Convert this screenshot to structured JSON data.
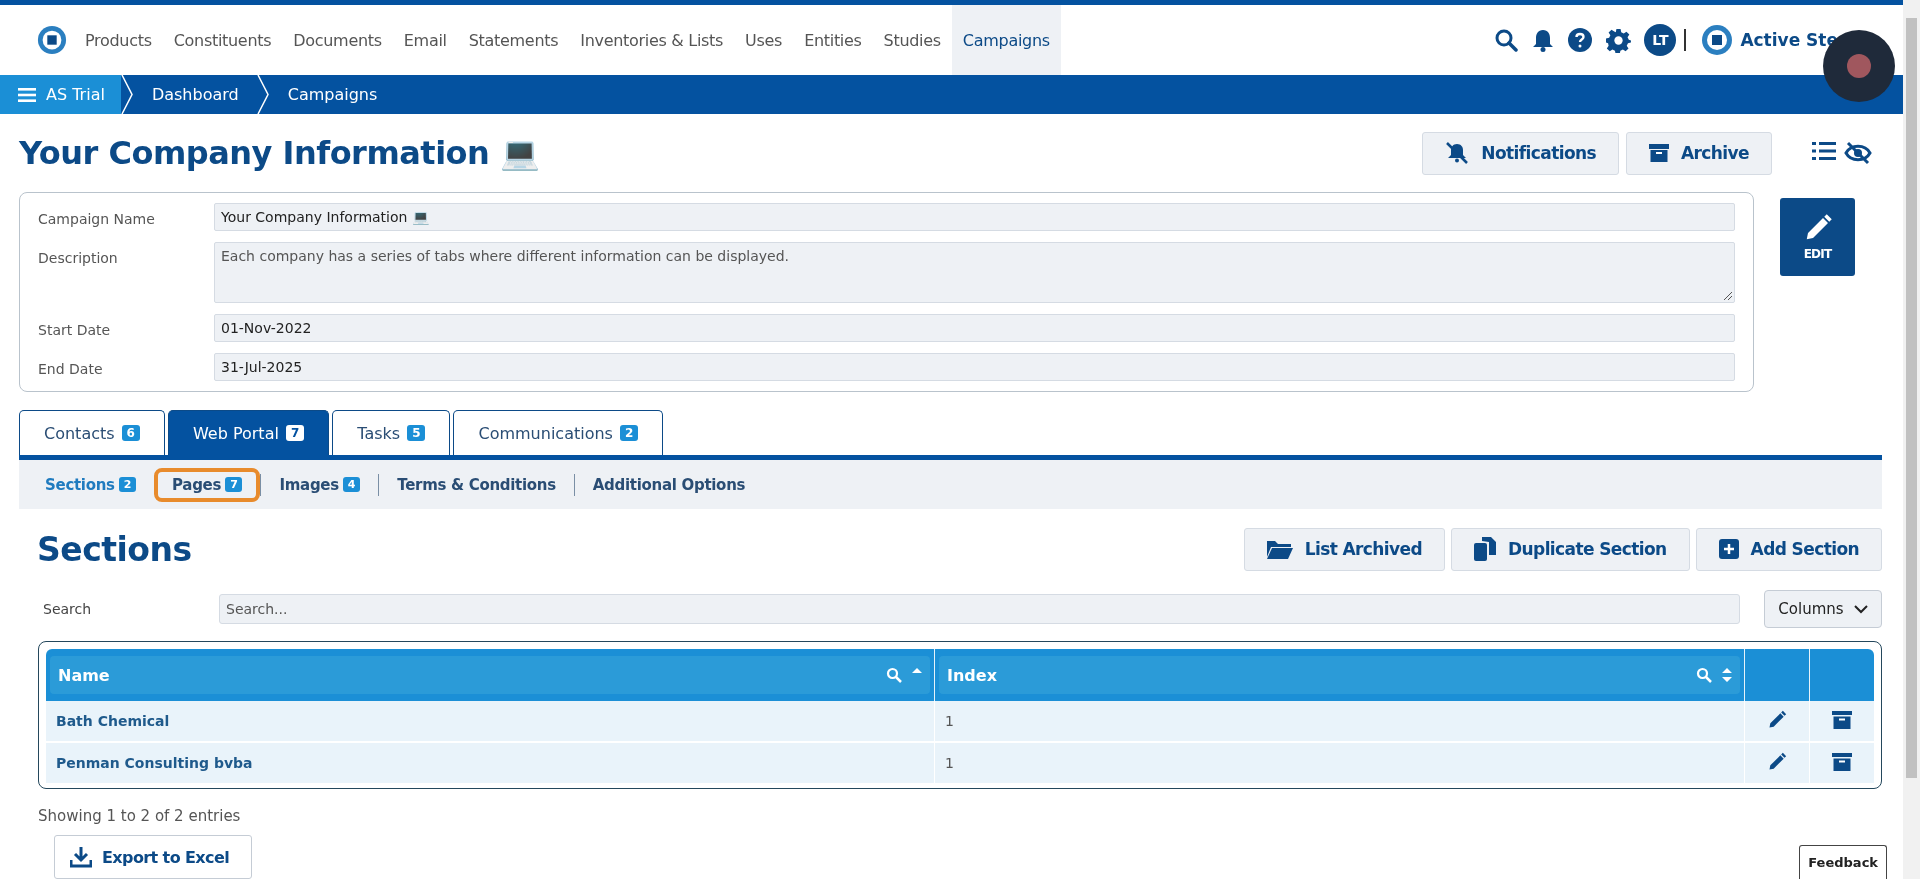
{
  "nav": {
    "items": [
      {
        "label": "Products",
        "selected": false
      },
      {
        "label": "Constituents",
        "selected": false
      },
      {
        "label": "Documents",
        "selected": false
      },
      {
        "label": "Email",
        "selected": false
      },
      {
        "label": "Statements",
        "selected": false
      },
      {
        "label": "Inventories & Lists",
        "selected": false
      },
      {
        "label": "Uses",
        "selected": false
      },
      {
        "label": "Entities",
        "selected": false
      },
      {
        "label": "Studies",
        "selected": false
      },
      {
        "label": "Campaigns",
        "selected": true
      }
    ],
    "avatar": "LT",
    "account": "Active Ste"
  },
  "breadcrumb": [
    "AS Trial",
    "Dashboard",
    "Campaigns"
  ],
  "page_title": "Your Company Information 💻",
  "header_buttons": [
    "Notifications",
    "Archive"
  ],
  "edit_button": "EDIT",
  "form": [
    {
      "label": "Campaign Name",
      "value": "Your Company Information 💻",
      "kind": "input"
    },
    {
      "label": "Description",
      "value": "Each company has a series of tabs where different information can be displayed.",
      "kind": "textarea"
    },
    {
      "label": "Start Date",
      "value": "01-Nov-2022",
      "kind": "input"
    },
    {
      "label": "End Date",
      "value": "31-Jul-2025",
      "kind": "input"
    }
  ],
  "tabs": [
    {
      "label": "Contacts",
      "count": "6",
      "selected": false
    },
    {
      "label": "Web Portal",
      "count": "7",
      "selected": true
    },
    {
      "label": "Tasks",
      "count": "5",
      "selected": false
    },
    {
      "label": "Communications",
      "count": "2",
      "selected": false
    }
  ],
  "subtabs": [
    {
      "label": "Sections",
      "count": "2",
      "selected": true,
      "highlighted": false
    },
    {
      "label": "Pages",
      "count": "7",
      "selected": false,
      "highlighted": true
    },
    {
      "label": "Images",
      "count": "4",
      "selected": false,
      "highlighted": false
    },
    {
      "label": "Terms & Conditions",
      "selected": false,
      "highlighted": false
    },
    {
      "label": "Additional Options",
      "selected": false,
      "highlighted": false
    }
  ],
  "section_title": "Sections",
  "action_buttons": [
    {
      "label": "List Archived",
      "kind": "folder"
    },
    {
      "label": "Duplicate Section",
      "kind": "copy"
    },
    {
      "label": "Add Section",
      "kind": "add"
    }
  ],
  "search": {
    "label": "Search",
    "placeholder": "Search..."
  },
  "columns_button": "Columns",
  "table": {
    "columns": [
      {
        "label": "Name",
        "kind": "sorted"
      },
      {
        "label": "Index",
        "kind": "sortable"
      }
    ],
    "rows": [
      {
        "name": "Bath Chemical",
        "index": "1"
      },
      {
        "name": "Penman Consulting bvba",
        "index": "1"
      }
    ]
  },
  "footer_text": "Showing 1 to 2 of 2 entries",
  "export_button": "Export to Excel",
  "feedback": "Feedback"
}
